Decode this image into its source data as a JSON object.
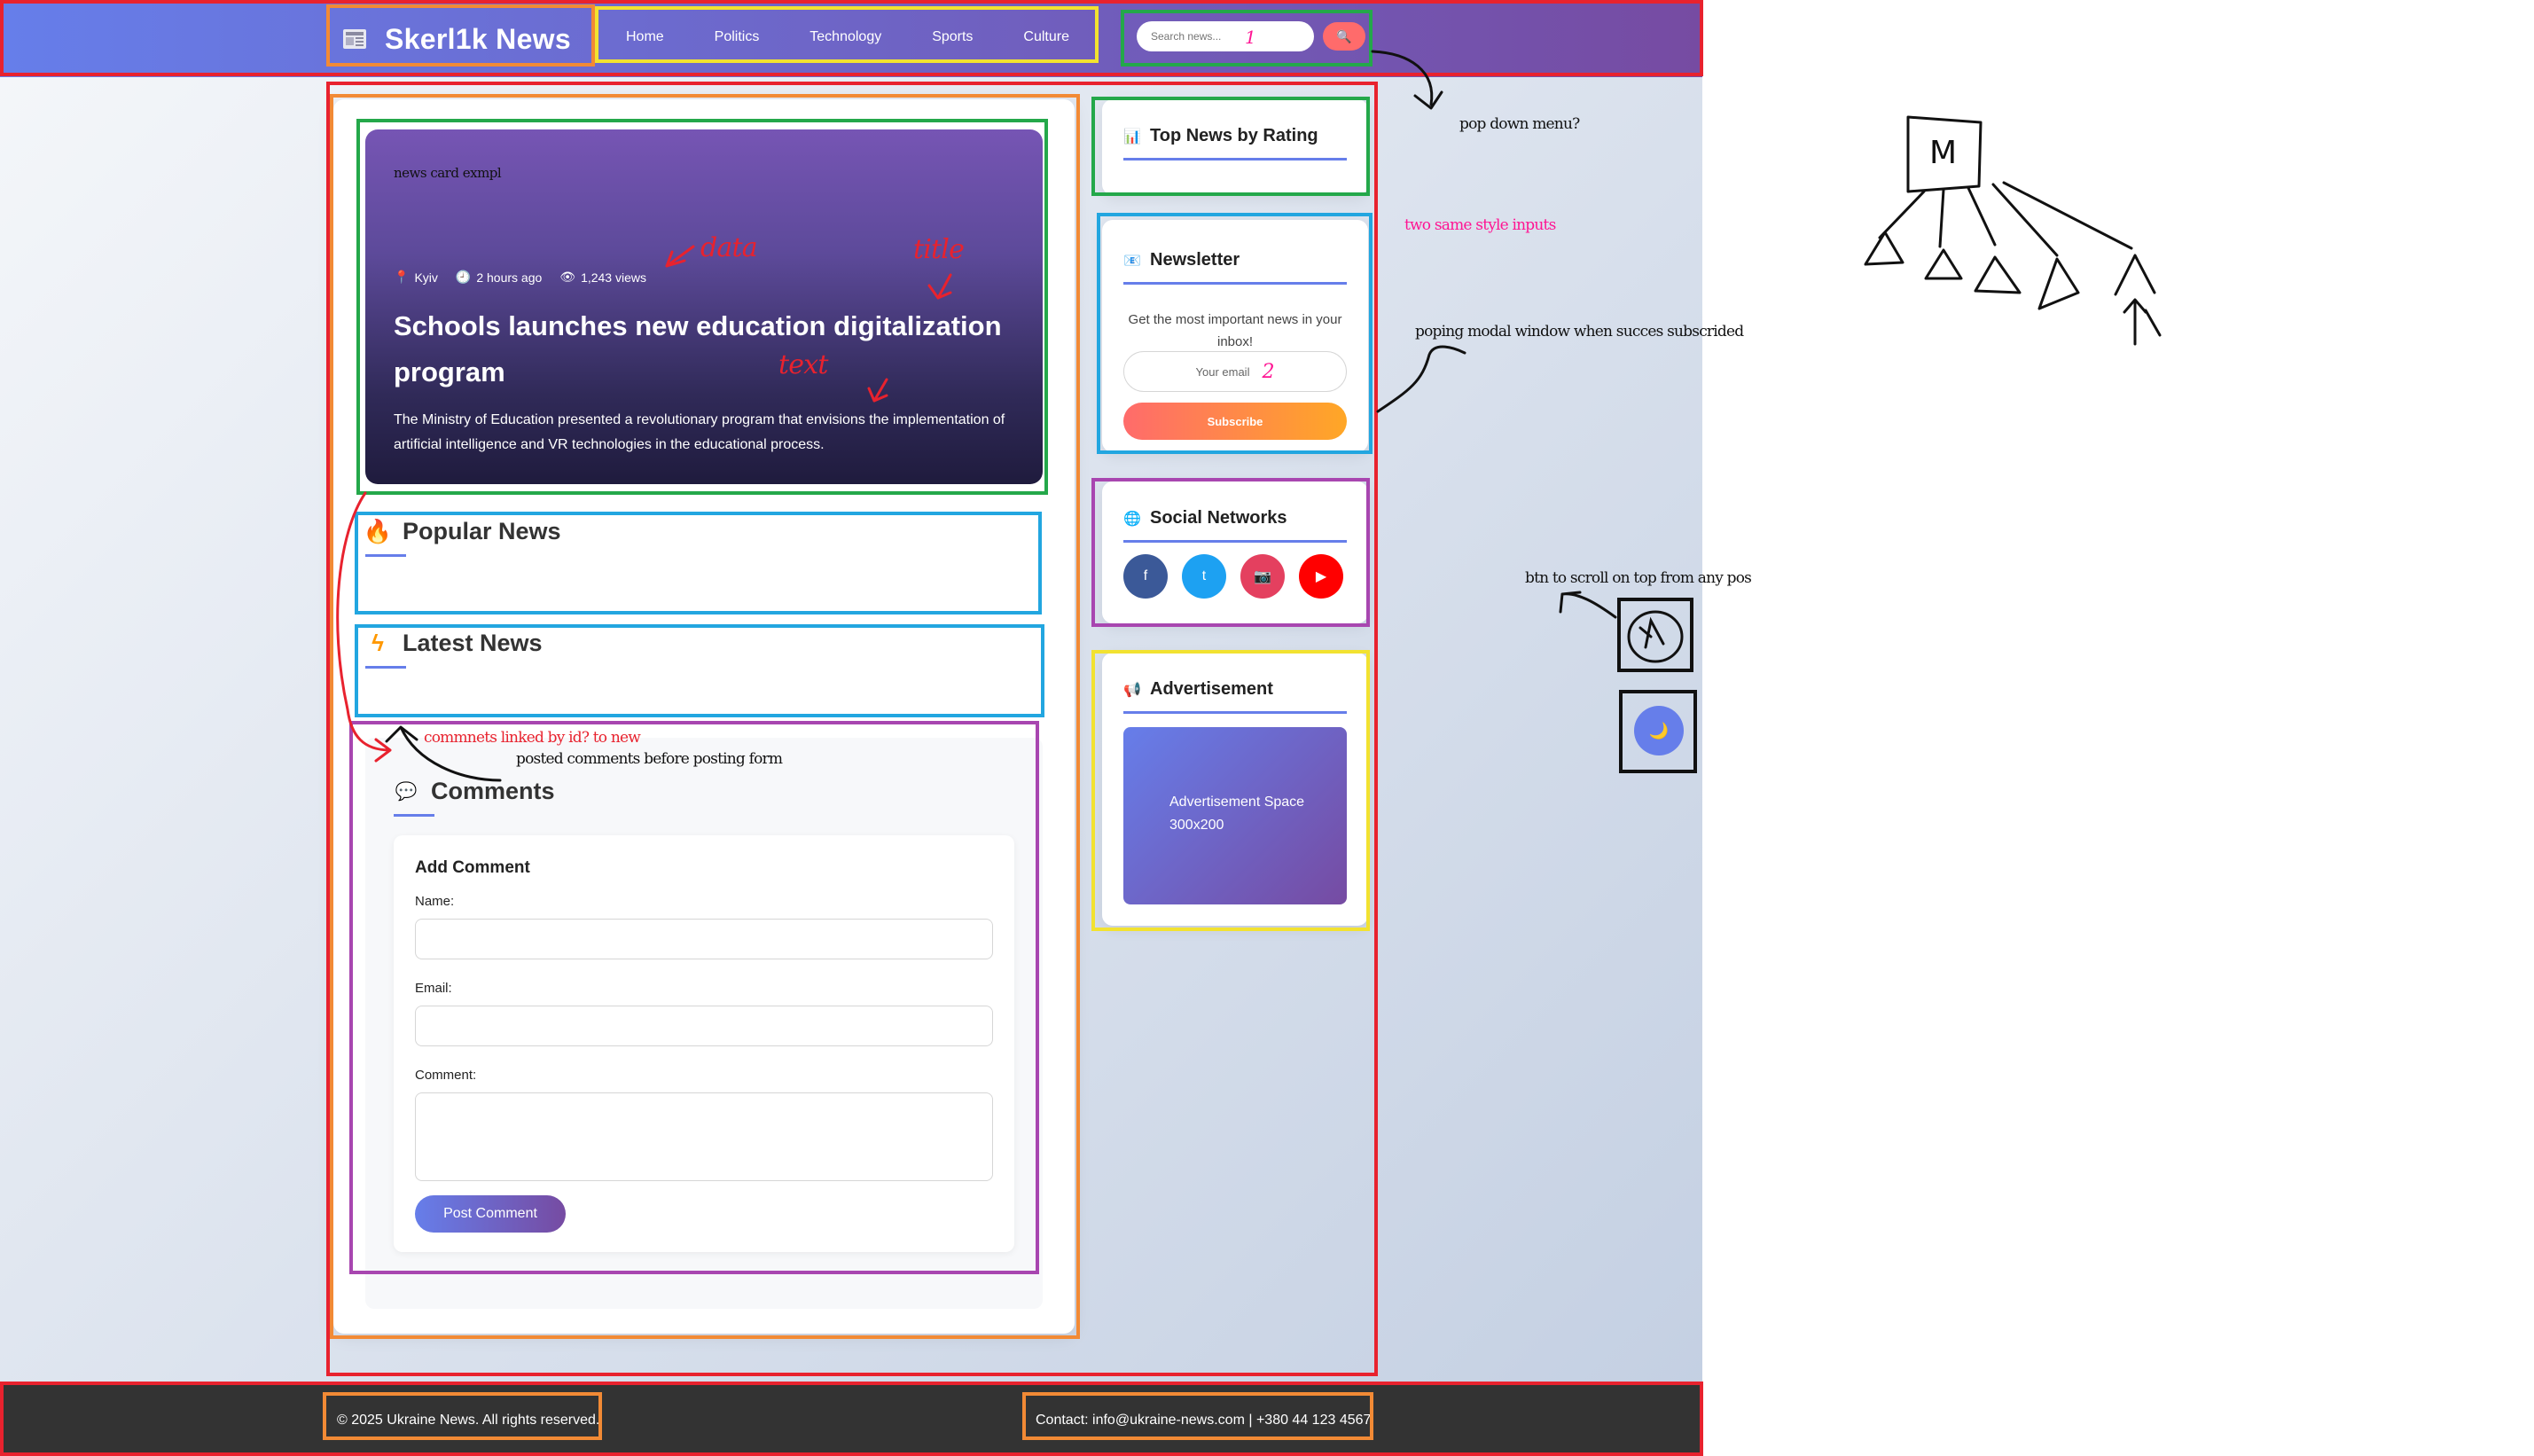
{
  "header": {
    "site_name": "Skerl1k News",
    "nav": [
      "Home",
      "Politics",
      "Technology",
      "Sports",
      "Culture"
    ],
    "search_placeholder": "Search news...",
    "search_mark": "1"
  },
  "hero": {
    "tag": "news card exmpl",
    "location": "Kyiv",
    "time": "2 hours ago",
    "views": "1,243 views",
    "title": "Schools launches new education digitalization program",
    "text": "The Ministry of Education presented a revolutionary program that envisions the implementation of artificial intelligence and VR technologies in the educational process."
  },
  "sections": {
    "popular": "Popular News",
    "latest": "Latest News",
    "comments": "Comments"
  },
  "comment_form": {
    "title": "Add Comment",
    "name_label": "Name:",
    "email_label": "Email:",
    "comment_label": "Comment:",
    "submit": "Post Comment"
  },
  "sidebar": {
    "top_news_title": "Top News by Rating",
    "newsletter_title": "Newsletter",
    "newsletter_desc": "Get the most important news in your inbox!",
    "newsletter_placeholder": "Your email",
    "newsletter_mark": "2",
    "subscribe": "Subscribe",
    "social_title": "Social Networks",
    "social": [
      {
        "label": "f",
        "color": "#3b5998"
      },
      {
        "label": "t",
        "color": "#1da1f2"
      },
      {
        "label": "📷",
        "color": "#e4405f"
      },
      {
        "label": "▶",
        "color": "#ff0000"
      }
    ],
    "ad_title": "Advertisement",
    "ad_text": "Advertisement Space 300x200"
  },
  "footer": {
    "copyright": "© 2025 Ukraine News. All rights reserved.",
    "contact": "Contact: info@ukraine-news.com | +380 44 123 4567"
  },
  "annotations": {
    "hero_data": "data",
    "hero_title": "title",
    "hero_text": "text",
    "pop_down": "pop down menu?",
    "same_inputs": "two same style inputs",
    "modal": "poping modal window when succes subscrided",
    "scroll_btn": "btn to scroll on top from any pos",
    "comments_link": "commnets linked by id? to new",
    "posted_comments": "posted comments before posting form",
    "sketch_letter": "M"
  },
  "colors": {
    "accent": "#667eea",
    "accent_dark": "#764ba2",
    "subscribe_start": "#ff6b6b",
    "subscribe_end": "#ffa726",
    "footer": "#333333"
  }
}
